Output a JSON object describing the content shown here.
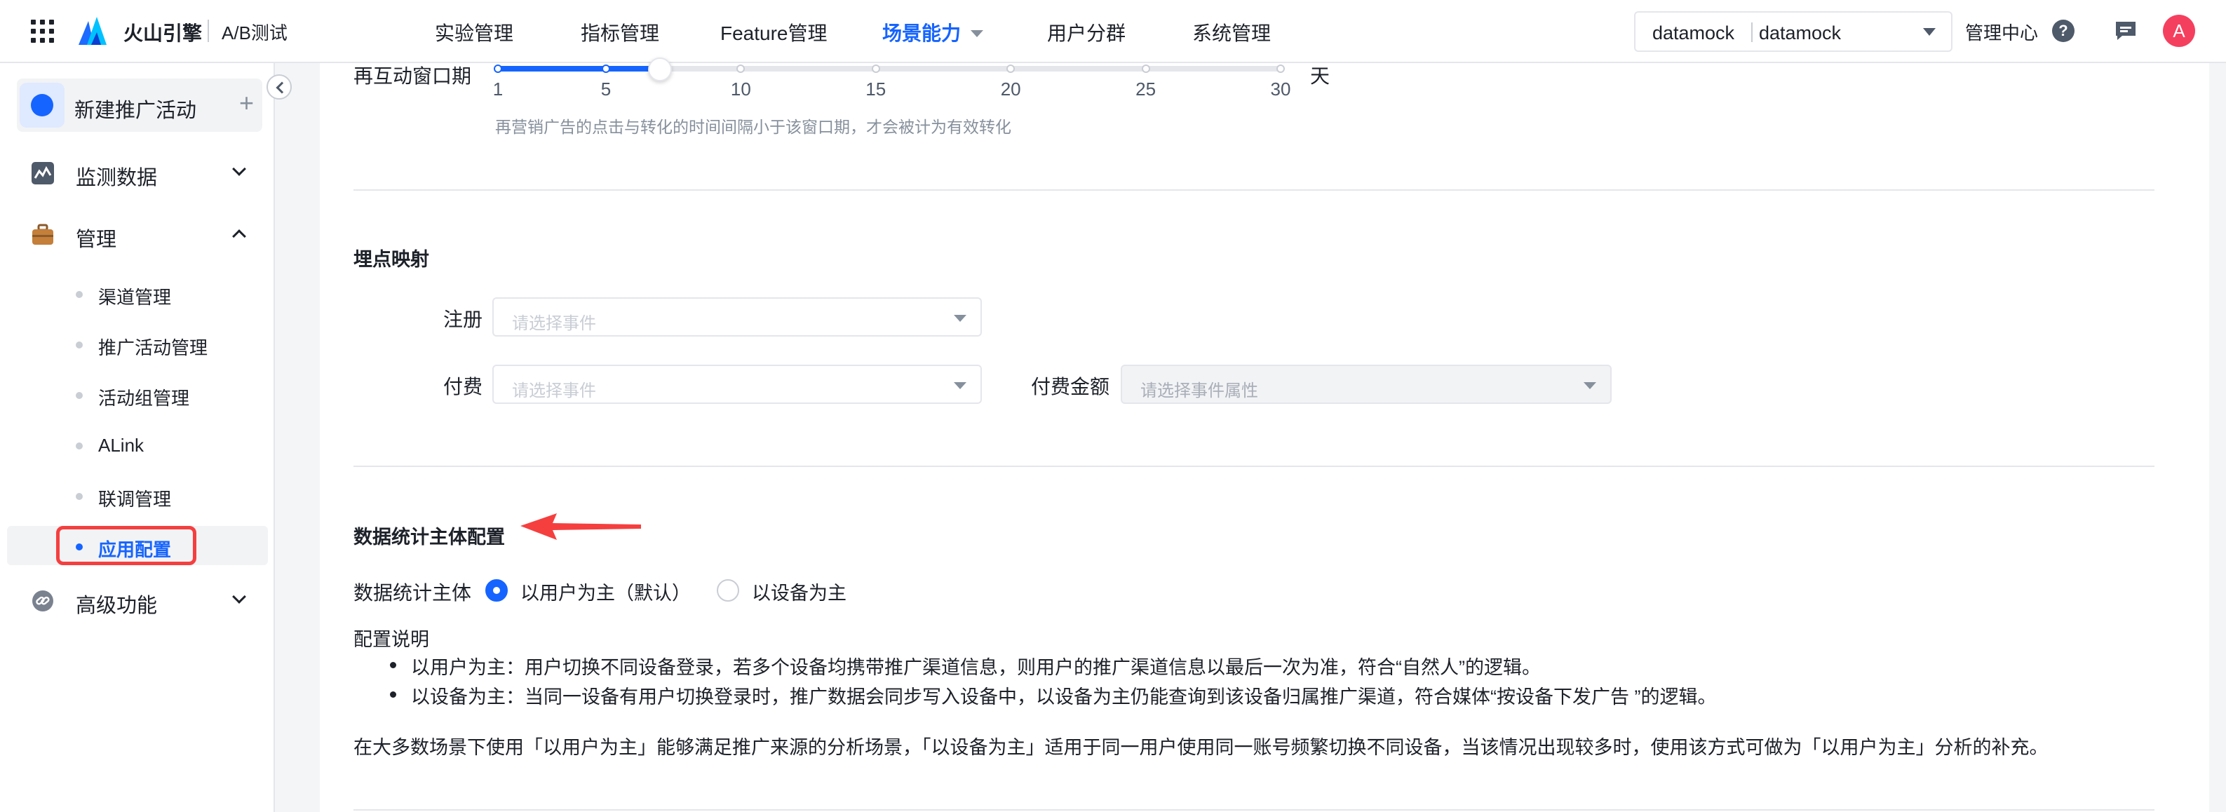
{
  "header": {
    "brand_name": "火山引擎",
    "brand_sub": "A/B测试",
    "nav": [
      {
        "label": "实验管理"
      },
      {
        "label": "指标管理"
      },
      {
        "label": "Feature管理"
      },
      {
        "label": "场景能力",
        "active": true
      },
      {
        "label": "用户分群"
      },
      {
        "label": "系统管理"
      }
    ],
    "project_left": "datamock",
    "project_right": "datamock",
    "manage_center": "管理中心",
    "avatar_letter": "A",
    "icons": [
      "apps-grid-icon",
      "logo-icon",
      "help-icon",
      "message-icon"
    ]
  },
  "sidebar": {
    "new_activity": "新建推广活动",
    "plus": "+",
    "items": [
      {
        "label": "监测数据",
        "icon": "monitor-chart-icon",
        "expanded": false
      },
      {
        "label": "管理",
        "icon": "briefcase-icon",
        "expanded": true
      },
      {
        "label": "高级功能",
        "icon": "link-icon",
        "expanded": false
      }
    ],
    "sub_items": [
      {
        "label": "渠道管理"
      },
      {
        "label": "推广活动管理"
      },
      {
        "label": "活动组管理"
      },
      {
        "label": "ALink"
      },
      {
        "label": "联调管理"
      },
      {
        "label": "应用配置",
        "active": true
      }
    ]
  },
  "main": {
    "window_label": "再互动窗口期",
    "slider": {
      "ticks": [
        "1",
        "5",
        "10",
        "15",
        "20",
        "25",
        "30"
      ],
      "tick_values": [
        1,
        5,
        10,
        15,
        20,
        25,
        30
      ],
      "min": 1,
      "max": 30,
      "value": 7,
      "unit": "天"
    },
    "window_hint": "再营销广告的点击与转化的时间间隔小于该窗口期，才会被计为有效转化",
    "mapping_title": "埋点映射",
    "register_label": "注册",
    "register_placeholder": "请选择事件",
    "pay_label": "付费",
    "pay_placeholder": "请选择事件",
    "pay_amount_label": "付费金额",
    "pay_amount_placeholder": "请选择事件属性",
    "stat_title": "数据统计主体配置",
    "stat_subject_label": "数据统计主体",
    "radio_user": "以用户为主（默认）",
    "radio_device": "以设备为主",
    "selected_subject": "user",
    "config_title": "配置说明",
    "bullet_1": "以用户为主：用户切换不同设备登录，若多个设备均携带推广渠道信息，则用户的推广渠道信息以最后一次为准，符合“自然人”的逻辑。",
    "bullet_2": "以设备为主：当同一设备有用户切换登录时，推广数据会同步写入设备中，以设备为主仍能查询到该设备归属推广渠道，符合媒体“按设备下发广告 ”的逻辑。",
    "summary": "在大多数场景下使用「以用户为主」能够满足推广来源的分析场景，「以设备为主」适用于同一用户使用同一账号频繁切换不同设备，当该情况出现较多时，使用该方式可做为「以用户为主」分析的补充。"
  },
  "colors": {
    "accent": "#1664ff",
    "annotation_red": "#f53f3f",
    "avatar": "#f53f5e"
  }
}
